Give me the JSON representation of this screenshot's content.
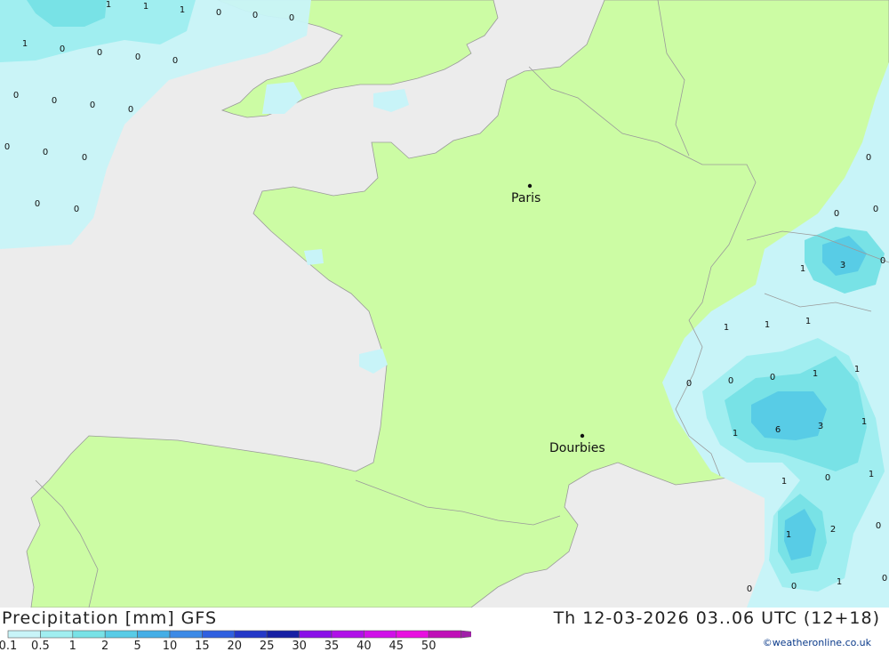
{
  "map": {
    "cities": [
      {
        "name": "Paris"
      },
      {
        "name": "Dourbies"
      }
    ],
    "values": [
      "1",
      "1",
      "1",
      "0",
      "0",
      "0",
      "1",
      "0",
      "0",
      "0",
      "0",
      "0",
      "0",
      "0",
      "0",
      "0",
      "0",
      "0",
      "0",
      "0",
      "0",
      "0",
      "0",
      "1",
      "3",
      "0",
      "1",
      "1",
      "1",
      "0",
      "0",
      "0",
      "1",
      "1",
      "1",
      "6",
      "3",
      "1",
      "1",
      "0",
      "1",
      "1",
      "2",
      "0",
      "0",
      "0",
      "1",
      "0"
    ]
  },
  "footer": {
    "title_left": "Precipitation [mm] GFS",
    "title_right": "Th 12-03-2026 03..06 UTC (12+18)",
    "credit": "©weatheronline.co.uk"
  },
  "legend": {
    "ticks": [
      "0.1",
      "0.5",
      "1",
      "2",
      "5",
      "10",
      "15",
      "20",
      "25",
      "30",
      "35",
      "40",
      "45",
      "50"
    ],
    "colors": [
      "#c8f4f8",
      "#a0eef0",
      "#78e2e6",
      "#58cce6",
      "#44aee6",
      "#3c8ae6",
      "#3060e0",
      "#2438c8",
      "#1620a4",
      "#8a10e8",
      "#b010e8",
      "#d010e8",
      "#e810e0",
      "#c010b8",
      "#a020a8"
    ]
  },
  "colors": {
    "sea": "#ececec",
    "land": "#ccfca4",
    "border": "#9a9a9a"
  }
}
